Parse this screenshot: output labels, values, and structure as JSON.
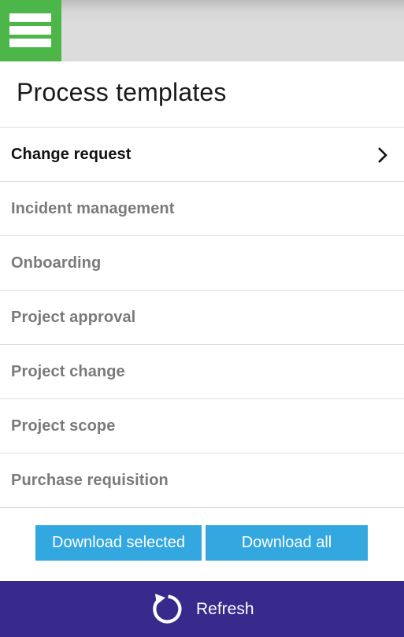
{
  "header": {
    "menu_icon": "hamburger-menu-icon",
    "accent_color": "#4cb748"
  },
  "page": {
    "title": "Process templates"
  },
  "templates": [
    {
      "label": "Change request",
      "selected": true
    },
    {
      "label": "Incident management",
      "selected": false
    },
    {
      "label": "Onboarding",
      "selected": false
    },
    {
      "label": "Project approval",
      "selected": false
    },
    {
      "label": "Project change",
      "selected": false
    },
    {
      "label": "Project scope",
      "selected": false
    },
    {
      "label": "Purchase requisition",
      "selected": false
    }
  ],
  "actions": {
    "download_selected_label": "Download selected",
    "download_all_label": "Download all",
    "button_color": "#33a7e0"
  },
  "footer": {
    "refresh_label": "Refresh",
    "refresh_icon": "refresh-icon",
    "background_color": "#382a8c"
  }
}
